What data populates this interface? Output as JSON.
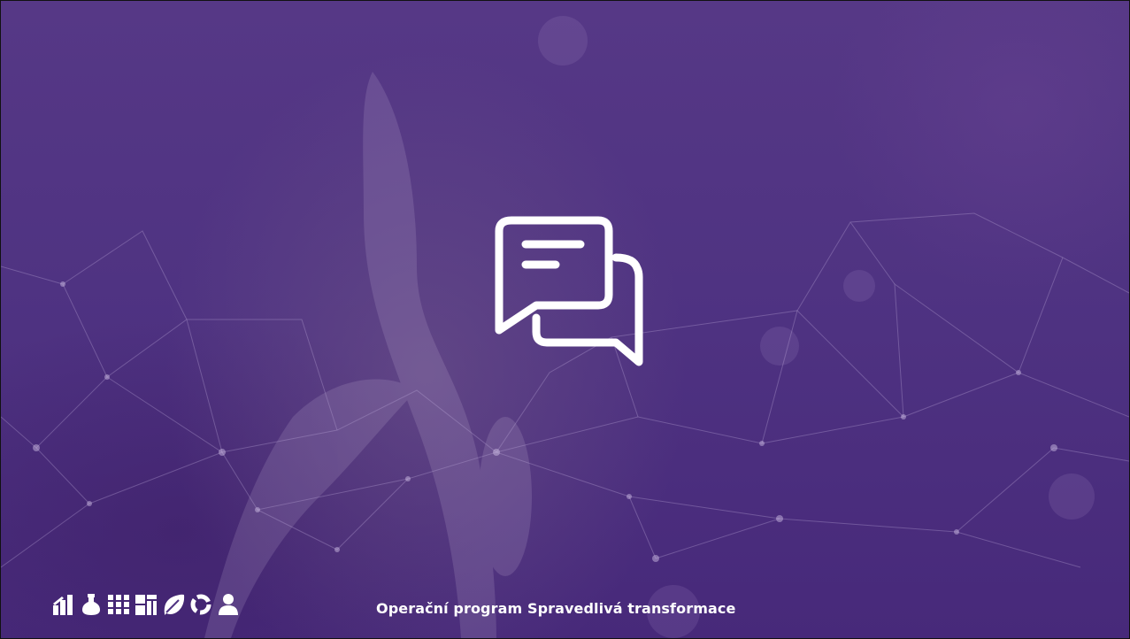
{
  "slide": {
    "footer_title": "Operační program Spravedlivá transformace",
    "center_icon": "chat-bubbles-icon",
    "logo_icons": [
      "bar-chart-icon",
      "flask-icon",
      "grid-icon",
      "puzzle-grid-icon",
      "leaf-icon",
      "recycle-icon",
      "person-icon"
    ],
    "colors": {
      "background": "#4f3382",
      "foreground": "#ffffff"
    }
  }
}
